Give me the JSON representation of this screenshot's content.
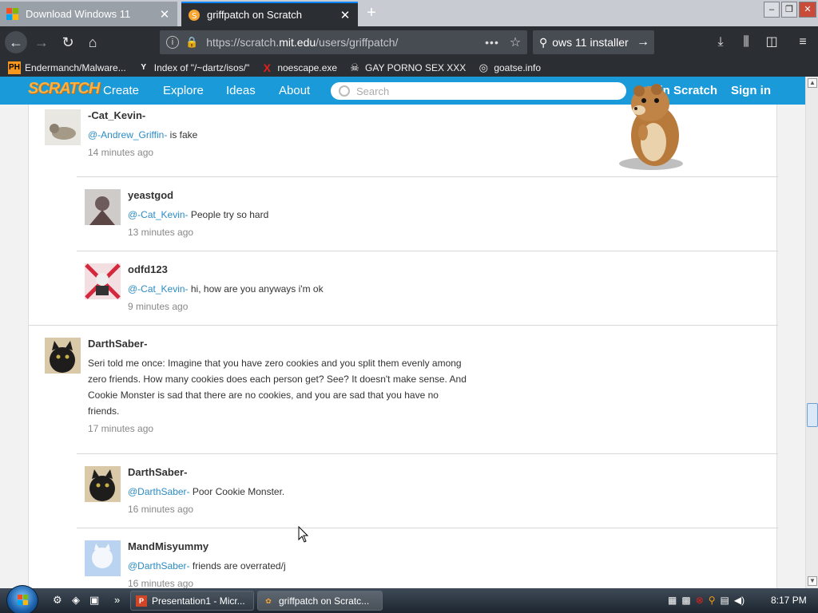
{
  "browser": {
    "tabs": [
      {
        "title": "Download Windows 11",
        "active": false
      },
      {
        "title": "griffpatch on Scratch",
        "active": true
      }
    ],
    "url_prefix": "https://scratch.",
    "url_domain": "mit.edu",
    "url_path": "/users/griffpatch/",
    "search_value": "ows 11 installer",
    "bookmarks": [
      {
        "icon": "PH",
        "label": "Endermanch/Malware..."
      },
      {
        "icon": "Y",
        "label": "Index of \"/~dartz/isos/\""
      },
      {
        "icon": "X",
        "label": "noescape.exe"
      },
      {
        "icon": "☠",
        "label": "GAY PORNO SEX XXX"
      },
      {
        "icon": "◎",
        "label": "goatse.info"
      }
    ]
  },
  "scratch": {
    "logo": "SCRATCH",
    "nav": {
      "create": "Create",
      "explore": "Explore",
      "ideas": "Ideas",
      "about": "About",
      "join": "Join Scratch",
      "signin": "Sign in"
    },
    "search_placeholder": "Search"
  },
  "comments": [
    {
      "user": "-Cat_Kevin-",
      "mention": "@-Andrew_Griffin-",
      "text": " is fake",
      "time": "14 minutes ago"
    },
    {
      "user": "yeastgod",
      "mention": "@-Cat_Kevin-",
      "text": " People try so hard",
      "time": "13 minutes ago"
    },
    {
      "user": "odfd123",
      "mention": "@-Cat_Kevin-",
      "text": " hi, how are you anyways i'm ok",
      "time": "9 minutes ago"
    },
    {
      "user": "DarthSaber-",
      "mention": "",
      "text": "Seri told me once: Imagine that you have zero cookies and you split them evenly among zero friends. How many cookies does each person get? See? It doesn't make sense. And Cookie Monster is sad that there are no cookies, and you are sad that you have no friends.",
      "time": "17 minutes ago"
    },
    {
      "user": "DarthSaber-",
      "mention": "@DarthSaber-",
      "text": " Poor Cookie Monster.",
      "time": "16 minutes ago"
    },
    {
      "user": "MandMisyummy",
      "mention": "@DarthSaber-",
      "text": " friends are overrated/j",
      "time": "16 minutes ago"
    }
  ],
  "taskbar": {
    "tasks": [
      "Presentation1 - Micr...",
      "griffpatch on Scratc..."
    ],
    "clock": "8:17 PM"
  }
}
